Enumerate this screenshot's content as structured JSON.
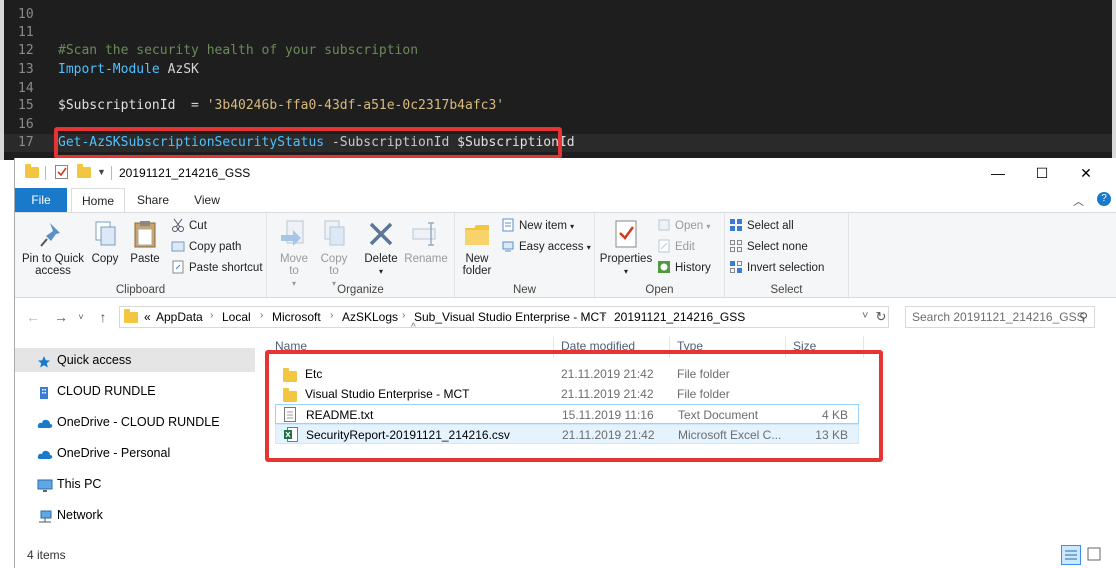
{
  "editor": {
    "lines": [
      {
        "num": "10",
        "tokens": []
      },
      {
        "num": "11",
        "tokens": []
      },
      {
        "num": "12",
        "tokens": [
          {
            "t": "#Scan the security health of your subscription",
            "c": "comment"
          }
        ]
      },
      {
        "num": "13",
        "tokens": [
          {
            "t": "Import-Module",
            "c": "cmd"
          },
          {
            "t": " AzSK",
            "c": "plain"
          }
        ]
      },
      {
        "num": "14",
        "tokens": []
      },
      {
        "num": "15",
        "tokens": [
          {
            "t": "$SubscriptionId",
            "c": "var"
          },
          {
            "t": "  = ",
            "c": "op"
          },
          {
            "t": "'3b40246b-ffa0-43df-a51e-0c2317b4afc3'",
            "c": "str"
          }
        ]
      },
      {
        "num": "16",
        "tokens": []
      },
      {
        "num": "17",
        "tokens": [
          {
            "t": "Get-AzSKSubscriptionSecurityStatus",
            "c": "cmd"
          },
          {
            "t": " -SubscriptionId ",
            "c": "param"
          },
          {
            "t": "$SubscriptionId",
            "c": "var"
          }
        ]
      }
    ],
    "highlight_color": "#e63333"
  },
  "window": {
    "title": "20191121_214216_GSS",
    "minimize": "—",
    "maximize": "☐",
    "close": "✕"
  },
  "ribbon_tabs": {
    "file": "File",
    "home": "Home",
    "share": "Share",
    "view": "View",
    "help": "?"
  },
  "clipboard": {
    "pin": "Pin to Quick access",
    "copy": "Copy",
    "paste": "Paste",
    "cut": "Cut",
    "copy_path": "Copy path",
    "paste_shortcut": "Paste shortcut",
    "label": "Clipboard"
  },
  "organize": {
    "move_to": "Move to",
    "copy_to": "Copy to",
    "delete": "Delete",
    "rename": "Rename",
    "label": "Organize"
  },
  "new": {
    "new_folder": "New folder",
    "new_item": "New item",
    "easy_access": "Easy access",
    "label": "New"
  },
  "open": {
    "properties": "Properties",
    "open": "Open",
    "edit": "Edit",
    "history": "History",
    "label": "Open"
  },
  "select": {
    "select_all": "Select all",
    "select_none": "Select none",
    "invert_selection": "Invert selection",
    "label": "Select"
  },
  "address": {
    "prefix": "«",
    "crumbs": [
      "AppData",
      "Local",
      "Microsoft",
      "AzSKLogs",
      "Sub_Visual Studio Enterprise - MCT",
      "20191121_214216_GSS"
    ],
    "search_placeholder": "Search 20191121_214216_GSS"
  },
  "nav": {
    "items": [
      {
        "label": "Quick access",
        "icon": "star-icon"
      },
      {
        "label": "CLOUD RUNDLE",
        "icon": "building-icon"
      },
      {
        "label": "OneDrive - CLOUD RUNDLE",
        "icon": "cloud-icon"
      },
      {
        "label": "OneDrive - Personal",
        "icon": "cloud-icon"
      },
      {
        "label": "This PC",
        "icon": "monitor-icon"
      },
      {
        "label": "Network",
        "icon": "network-icon"
      }
    ]
  },
  "columns": {
    "name": "Name",
    "date": "Date modified",
    "type": "Type",
    "size": "Size"
  },
  "files": [
    {
      "name": "Etc",
      "date": "21.11.2019 21:42",
      "type": "File folder",
      "size": "",
      "icon": "folder-icon"
    },
    {
      "name": "Visual Studio Enterprise - MCT",
      "date": "21.11.2019 21:42",
      "type": "File folder",
      "size": "",
      "icon": "folder-icon"
    },
    {
      "name": "README.txt",
      "date": "15.11.2019 11:16",
      "type": "Text Document",
      "size": "4 KB",
      "icon": "text-file-icon"
    },
    {
      "name": "SecurityReport-20191121_214216.csv",
      "date": "21.11.2019 21:42",
      "type": "Microsoft Excel C...",
      "size": "13 KB",
      "icon": "excel-file-icon"
    }
  ],
  "status": {
    "items_count": "4 items"
  },
  "colors": {
    "accent": "#1979ca",
    "highlight": "#e63333",
    "folder": "#f3c642"
  }
}
